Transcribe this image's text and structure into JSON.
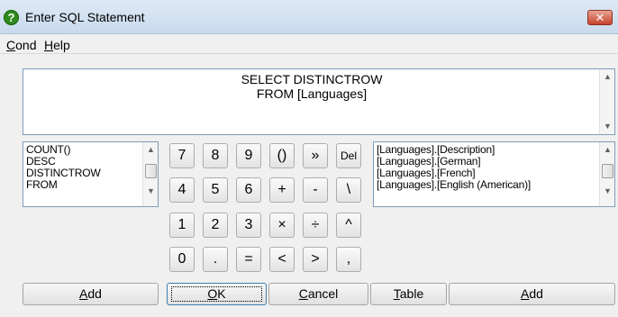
{
  "window": {
    "title": "Enter SQL Statement",
    "close_glyph": "✕",
    "help_icon_glyph": "?"
  },
  "menu": {
    "items": [
      {
        "mnemonic": "C",
        "rest": "ond"
      },
      {
        "mnemonic": "H",
        "rest": "elp"
      }
    ]
  },
  "sql": {
    "lines": [
      "SELECT DISTINCTROW",
      "FROM [Languages]"
    ]
  },
  "keywords_list": {
    "items": [
      "COUNT()",
      "DESC",
      "DISTINCTROW",
      "FROM"
    ]
  },
  "fields_list": {
    "items": [
      "[Languages].[Description]",
      "[Languages].[German]",
      "[Languages].[French]",
      "[Languages].[English (American)]"
    ]
  },
  "keypad": {
    "rows": [
      [
        "7",
        "8",
        "9",
        "()",
        "»",
        "Del"
      ],
      [
        "4",
        "5",
        "6",
        "+",
        "-",
        "\\"
      ],
      [
        "1",
        "2",
        "3",
        "×",
        "÷",
        "^"
      ],
      [
        "0",
        ".",
        "=",
        "<",
        ">",
        ","
      ]
    ]
  },
  "buttons": {
    "add_left": {
      "mnemonic": "A",
      "rest": "dd"
    },
    "ok": {
      "mnemonic": "O",
      "rest": "K"
    },
    "cancel": {
      "mnemonic": "C",
      "rest": "ancel"
    },
    "table": {
      "mnemonic": "T",
      "rest": "able"
    },
    "add_right": {
      "mnemonic": "A",
      "rest": "dd"
    }
  },
  "icons": {
    "scroll_up": "▲",
    "scroll_down": "▼"
  }
}
